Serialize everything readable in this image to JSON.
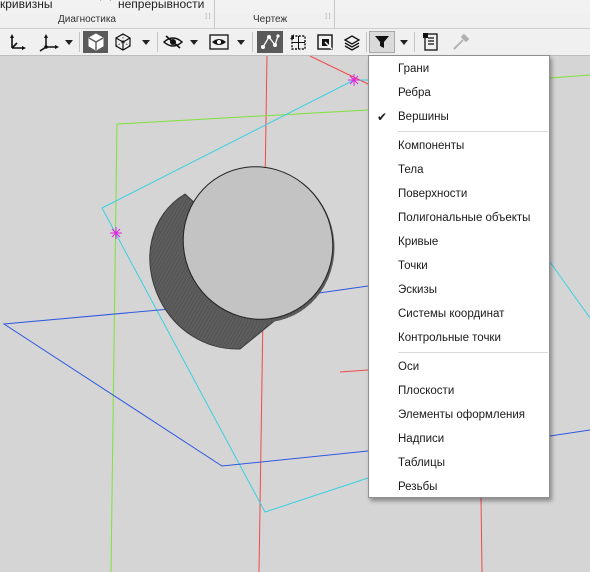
{
  "ribbon": {
    "top_labels": [
      "кривизны",
      "непрерывности"
    ],
    "groups": [
      "Диагностика",
      "Чертеж"
    ]
  },
  "toolbar": {
    "buttons": [
      {
        "icon": "move-axes-icon"
      },
      {
        "icon": "local-axes-icon"
      },
      {
        "icon": "shaded-cube-icon",
        "state": "active"
      },
      {
        "icon": "wireframe-cube-icon"
      },
      {
        "icon": "hide-eye-icon"
      },
      {
        "icon": "display-mode-eye-icon"
      },
      {
        "icon": "vertex-select-icon",
        "state": "active"
      },
      {
        "icon": "grid-select-icon"
      },
      {
        "icon": "component-select-icon"
      },
      {
        "icon": "layers-select-icon"
      },
      {
        "icon": "filter-icon",
        "state": "pressed"
      },
      {
        "icon": "model-properties-icon"
      },
      {
        "icon": "eyedropper-icon",
        "state": "disabled"
      }
    ]
  },
  "filter_menu": {
    "groups": [
      [
        {
          "label": "Грани",
          "checked": false
        },
        {
          "label": "Ребра",
          "checked": false
        },
        {
          "label": "Вершины",
          "checked": true
        }
      ],
      [
        {
          "label": "Компоненты",
          "checked": false
        },
        {
          "label": "Тела",
          "checked": false
        },
        {
          "label": "Поверхности",
          "checked": false
        },
        {
          "label": "Полигональные объекты",
          "checked": false
        },
        {
          "label": "Кривые",
          "checked": false
        },
        {
          "label": "Точки",
          "checked": false
        },
        {
          "label": "Эскизы",
          "checked": false
        },
        {
          "label": "Системы координат",
          "checked": false
        },
        {
          "label": "Контрольные точки",
          "checked": false
        }
      ],
      [
        {
          "label": "Оси",
          "checked": false
        },
        {
          "label": "Плоскости",
          "checked": false
        },
        {
          "label": "Элементы оформления",
          "checked": false
        },
        {
          "label": "Надписи",
          "checked": false
        },
        {
          "label": "Таблицы",
          "checked": false
        },
        {
          "label": "Резьбы",
          "checked": false
        }
      ]
    ],
    "check_glyph": "✔"
  },
  "colors": {
    "viewport_bg": "#d5d5d5",
    "plane_green": "#7fe23a",
    "plane_cyan": "#39d0e0",
    "plane_blue": "#2f58e0",
    "axis_red": "#f04a4a",
    "point_magenta": "#e020e0",
    "cylinder_face": "#bfbfbf",
    "cylinder_side": "#5a5a5a"
  }
}
